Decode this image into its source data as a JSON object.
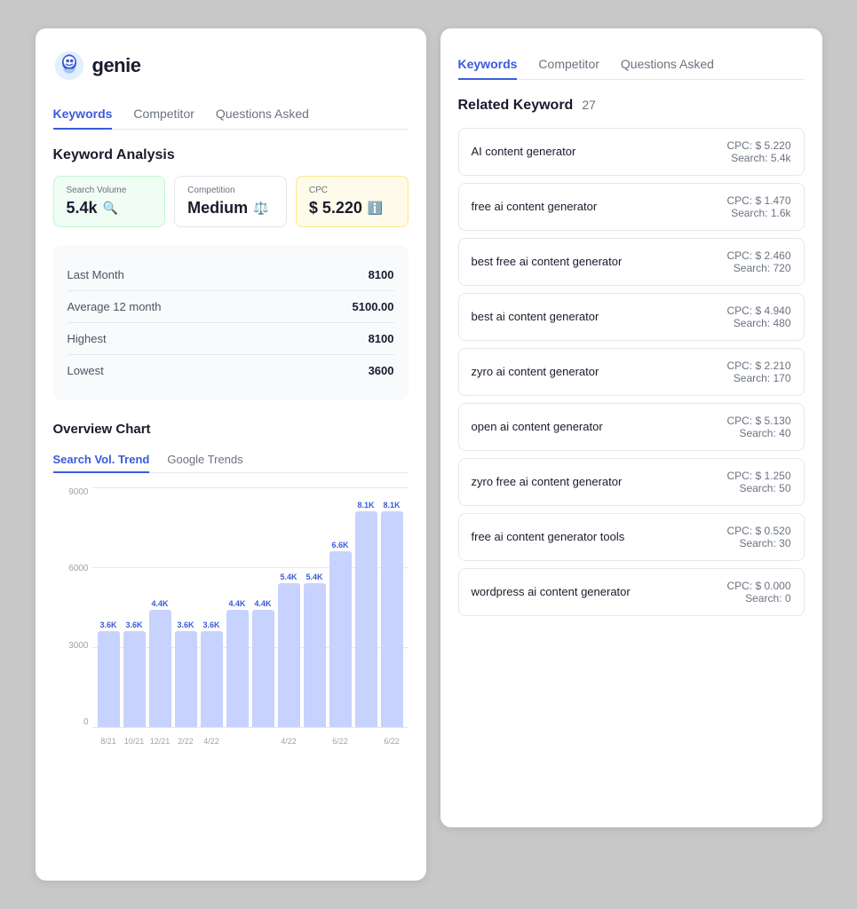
{
  "app": {
    "logo_text": "genie"
  },
  "left_panel": {
    "tabs": [
      {
        "label": "Keywords",
        "active": true
      },
      {
        "label": "Competitor",
        "active": false
      },
      {
        "label": "Questions Asked",
        "active": false
      }
    ],
    "section_title": "Keyword Analysis",
    "stats": {
      "search_volume": {
        "label": "Search Volume",
        "value": "5.4k",
        "box_type": "green"
      },
      "competition": {
        "label": "Competition",
        "value": "Medium",
        "box_type": "white"
      },
      "cpc": {
        "label": "CPC",
        "value": "$ 5.220",
        "box_type": "yellow"
      }
    },
    "metrics": [
      {
        "label": "Last Month",
        "value": "8100"
      },
      {
        "label": "Average 12 month",
        "value": "5100.00"
      },
      {
        "label": "Highest",
        "value": "8100"
      },
      {
        "label": "Lowest",
        "value": "3600"
      }
    ],
    "chart": {
      "section_title": "Overview Chart",
      "tabs": [
        {
          "label": "Search Vol. Trend",
          "active": true
        },
        {
          "label": "Google Trends",
          "active": false
        }
      ],
      "y_labels": [
        "9000",
        "6000",
        "3000",
        "0"
      ],
      "bars": [
        {
          "x_label": "8/21",
          "value": 3600,
          "display": "3.6K"
        },
        {
          "x_label": "10/21",
          "value": 3600,
          "display": "3.6K"
        },
        {
          "x_label": "12/21",
          "value": 4400,
          "display": "4.4K"
        },
        {
          "x_label": "2/22",
          "value": 3600,
          "display": "3.6K"
        },
        {
          "x_label": "4/22",
          "value": 3600,
          "display": "3.6K"
        },
        {
          "x_label": "",
          "value": 4400,
          "display": "4.4K"
        },
        {
          "x_label": "",
          "value": 4400,
          "display": "4.4K"
        },
        {
          "x_label": "4/22",
          "value": 5400,
          "display": "5.4K"
        },
        {
          "x_label": "",
          "value": 5400,
          "display": "5.4K"
        },
        {
          "x_label": "6/22",
          "value": 6600,
          "display": "6.6K"
        },
        {
          "x_label": "",
          "value": 8100,
          "display": "8.1K"
        },
        {
          "x_label": "6/22",
          "value": 8100,
          "display": "8.1K"
        }
      ],
      "max_value": 9000
    }
  },
  "right_panel": {
    "tabs": [
      {
        "label": "Keywords",
        "active": true
      },
      {
        "label": "Competitor",
        "active": false
      },
      {
        "label": "Questions Asked",
        "active": false
      }
    ],
    "related_title": "Related Keyword",
    "related_count": "27",
    "keywords": [
      {
        "name": "AI content generator",
        "cpc": "CPC: $ 5.220",
        "search": "Search: 5.4k"
      },
      {
        "name": "free ai content generator",
        "cpc": "CPC: $ 1.470",
        "search": "Search: 1.6k"
      },
      {
        "name": "best free ai content generator",
        "cpc": "CPC: $ 2.460",
        "search": "Search: 720"
      },
      {
        "name": "best ai content generator",
        "cpc": "CPC: $ 4.940",
        "search": "Search: 480"
      },
      {
        "name": "zyro ai content generator",
        "cpc": "CPC: $ 2.210",
        "search": "Search: 170"
      },
      {
        "name": "open ai content generator",
        "cpc": "CPC: $ 5.130",
        "search": "Search: 40"
      },
      {
        "name": "zyro free ai content generator",
        "cpc": "CPC: $ 1.250",
        "search": "Search: 50"
      },
      {
        "name": "free ai content generator tools",
        "cpc": "CPC: $ 0.520",
        "search": "Search: 30"
      },
      {
        "name": "wordpress ai content generator",
        "cpc": "CPC: $ 0.000",
        "search": "Search: 0"
      }
    ]
  }
}
